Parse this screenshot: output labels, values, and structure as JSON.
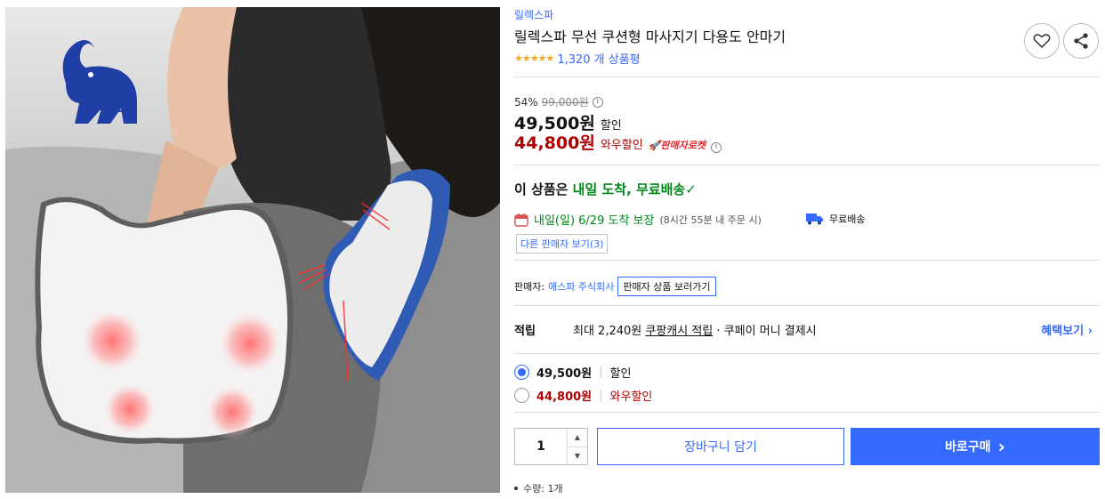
{
  "image": {
    "logo_text": "릴렉스파"
  },
  "product": {
    "brand": "릴렉스파",
    "title": "릴렉스파 무선 쿠션형 마사지기 다용도 안마기",
    "stars": "★★★★★",
    "review_count": "1,320 개 상품평"
  },
  "icons": {
    "wish": "heart-icon",
    "share": "share-icon",
    "info": "info-icon",
    "calendar": "calendar-icon",
    "truck": "truck-icon",
    "chevron": "chevron-right-icon"
  },
  "pricing": {
    "discount_rate": "54%",
    "original_price": "99,000원",
    "info_glyph": "i",
    "sale_price": "49,500원",
    "sale_label": "할인",
    "wow_price": "44,800원",
    "wow_label": "와우할인",
    "rocket_badge": "🚀판매자로켓"
  },
  "delivery": {
    "headline_prefix": "이 상품은 ",
    "headline_green": "내일 도착, 무료배송",
    "check": "✓",
    "arrival": "내일(일) 6/29 도착 보장",
    "arrival_sub": "(8시간 55분 내 주문 시)",
    "free_shipping": "무료배송",
    "other_sellers": "다른 판매자 보기(3)"
  },
  "seller": {
    "label": "판매자:",
    "name": "애스파 주식회사",
    "view_products": "판매자 상품 보러가기"
  },
  "reward": {
    "label": "적립",
    "text_prefix": "최대 2,240원 ",
    "cash_link": "쿠팡캐시 적립",
    "text_suffix": " · 쿠페이 머니 결제시",
    "benefit_link": "혜택보기"
  },
  "options": [
    {
      "price": "49,500원",
      "label": "할인",
      "selected": true
    },
    {
      "price": "44,800원",
      "label": "와우할인",
      "selected": false
    }
  ],
  "purchase": {
    "quantity": "1",
    "up": "▲",
    "down": "▼",
    "cart_label": "장바구니 담기",
    "buy_label": "바로구매",
    "buy_chevron": "›",
    "qty_note": "수량: 1개"
  },
  "colors": {
    "accent": "#346aff",
    "wow_red": "#ae0000",
    "delivery_green": "#00891a",
    "star": "#f5a623"
  }
}
